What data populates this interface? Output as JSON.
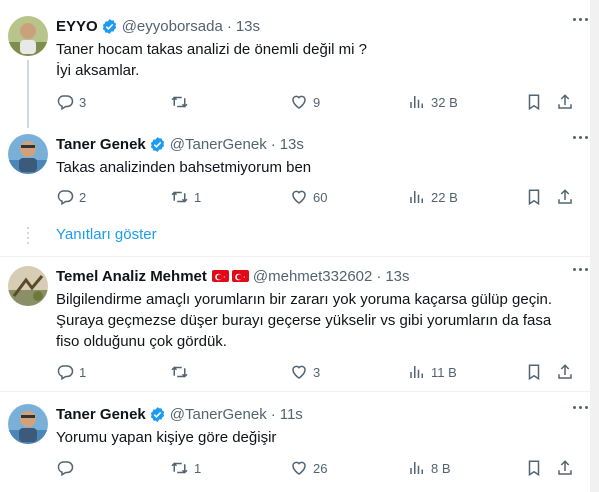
{
  "tweets": [
    {
      "name": "EYYO",
      "handle": "@eyyoborsada",
      "time": "13s",
      "lines": [
        "Taner hocam takas analizi de önemli değil mi ?",
        "İyi aksamlar."
      ],
      "stats": {
        "replies": "3",
        "retweets": "",
        "likes": "9",
        "views": "32 B"
      }
    },
    {
      "name": "Taner Genek",
      "handle": "@TanerGenek",
      "time": "13s",
      "lines": [
        "Takas analizinden bahsetmiyorum ben"
      ],
      "stats": {
        "replies": "2",
        "retweets": "1",
        "likes": "60",
        "views": "22 B"
      }
    },
    {
      "name": "Temel Analiz Mehmet",
      "handle": "@mehmet332602",
      "time": "13s",
      "lines": [
        "Bilgilendirme amaçlı yorumların bir zararı yok yoruma kaçarsa gülüp geçin.",
        "Şuraya geçmezse düşer burayı geçerse yükselir vs gibi yorumların da fasa",
        "fiso olduğunu çok gördük."
      ],
      "stats": {
        "replies": "1",
        "retweets": "",
        "likes": "3",
        "views": "11 B"
      }
    },
    {
      "name": "Taner Genek",
      "handle": "@TanerGenek",
      "time": "11s",
      "lines": [
        "Yorumu yapan kişiye göre değişir"
      ],
      "stats": {
        "replies": "",
        "retweets": "1",
        "likes": "26",
        "views": "8 B"
      }
    }
  ],
  "show_replies": "Yanıtları göster",
  "colors": {
    "accent": "#1d9bf0",
    "muted": "#536471",
    "text": "#0f1419",
    "flag": "#e30a17"
  }
}
